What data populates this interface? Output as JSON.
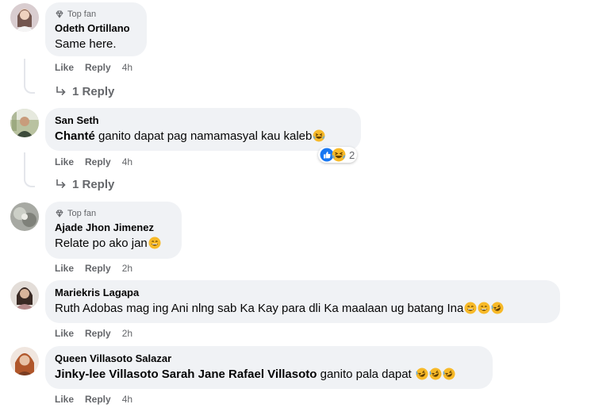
{
  "actions": {
    "like": "Like",
    "reply": "Reply"
  },
  "comments": [
    {
      "badge": "Top fan",
      "author": "Odeth Ortillano",
      "text": "Same here.",
      "time": "4h",
      "replies": "1 Reply"
    },
    {
      "author": "San Seth",
      "tag": "Chanté",
      "text": " ganito dapat pag namamasyal kau kaleb",
      "time": "4h",
      "reaction_count": "2",
      "replies": "1 Reply"
    },
    {
      "badge": "Top fan",
      "author": "Ajade Jhon Jimenez",
      "text": "Relate po ako jan",
      "time": "2h"
    },
    {
      "author": "Mariekris Lagapa",
      "text": "Ruth Adobas mag ing Ani nlng sab Ka Kay para dli Ka maalaan ug batang Ina",
      "time": "2h"
    },
    {
      "author": "Queen Villasoto Salazar",
      "tag": "Jinky-lee Villasoto Sarah Jane Rafael Villasoto",
      "text": " ganito pala dapat ",
      "time": "4h"
    }
  ],
  "colors": {
    "bubble": "#f0f2f5",
    "meta": "#65676b",
    "like_blue": "#1877f2",
    "emoji_yellow": "#fbbf24"
  },
  "icons": [
    "diamond-icon",
    "reply-arrow-icon",
    "like-reaction-icon",
    "haha-reaction-icon",
    "grin-emoji-icon",
    "laugh-emoji-icon"
  ]
}
